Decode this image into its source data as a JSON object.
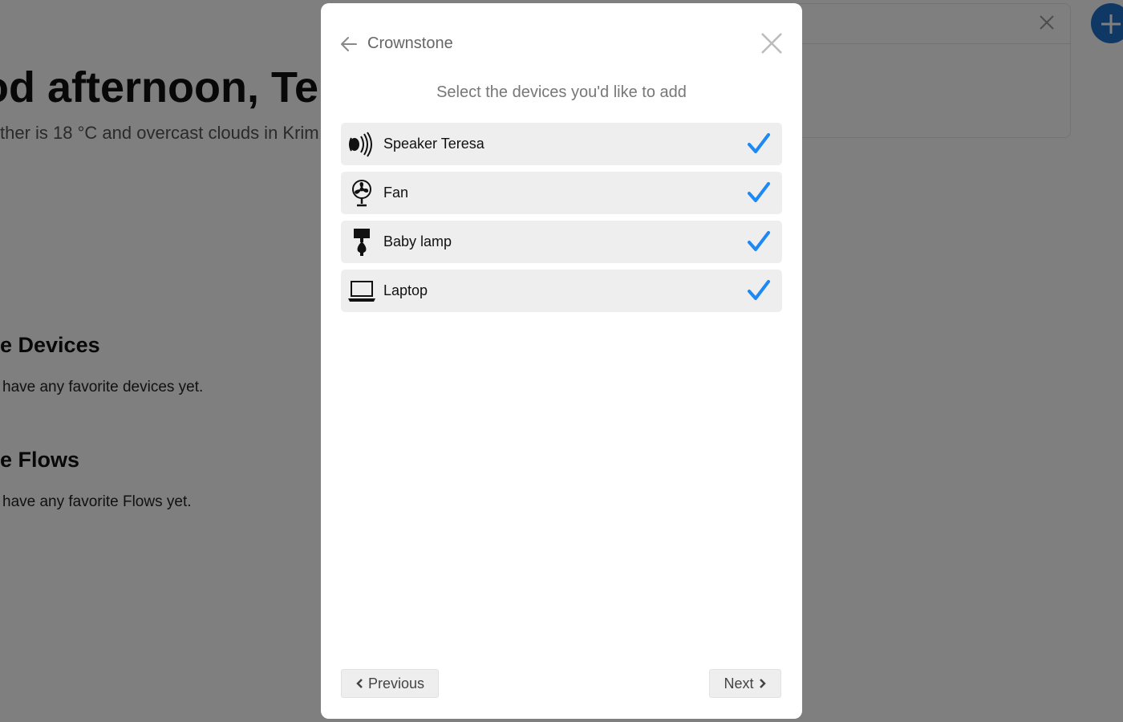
{
  "background": {
    "greeting": "od afternoon, Tere",
    "weather": "ther is 18 °C and overcast clouds in Krim",
    "favorite_devices_title": "e Devices",
    "favorite_devices_text": "have any favorite devices yet.",
    "favorite_flows_title": "e Flows",
    "favorite_flows_text": "have any favorite Flows yet."
  },
  "modal": {
    "title": "Crownstone",
    "subtitle": "Select the devices you'd like to add",
    "devices": [
      {
        "label": "Speaker Teresa",
        "icon": "speaker-icon",
        "selected": true
      },
      {
        "label": "Fan",
        "icon": "fan-icon",
        "selected": true
      },
      {
        "label": "Baby lamp",
        "icon": "lamp-icon",
        "selected": true
      },
      {
        "label": "Laptop",
        "icon": "laptop-icon",
        "selected": true
      }
    ],
    "previous_label": "Previous",
    "next_label": "Next"
  },
  "colors": {
    "accent": "#1e88f5",
    "fab": "#1e73c8",
    "item_bg": "#eeeeee"
  }
}
